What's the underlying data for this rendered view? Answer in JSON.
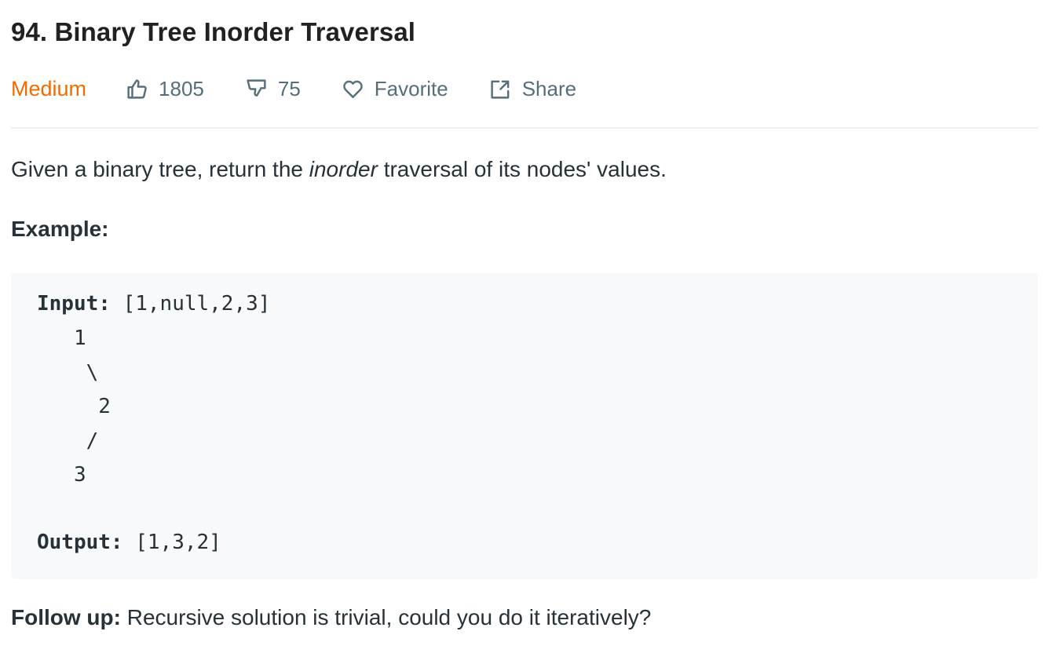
{
  "problem": {
    "title": "94. Binary Tree Inorder Traversal",
    "difficulty": "Medium",
    "likes": "1805",
    "dislikes": "75",
    "favorite_label": "Favorite",
    "share_label": "Share"
  },
  "description": {
    "before_em": "Given a binary tree, return the ",
    "em": "inorder",
    "after_em": " traversal of its nodes' values."
  },
  "example": {
    "heading": "Example:",
    "input_label": "Input:",
    "input_value": " [1,null,2,3]",
    "tree_lines": [
      "   1",
      "    \\",
      "     2",
      "    /",
      "   3"
    ],
    "output_label": "Output:",
    "output_value": " [1,3,2]"
  },
  "followup": {
    "label": "Follow up:",
    "text": " Recursive solution is trivial, could you do it iteratively?"
  },
  "colors": {
    "difficulty_medium": "#ef6c00",
    "meta_text": "#546e7a",
    "code_background": "#f7f9fa"
  },
  "icons": {
    "likes": "thumbs-up-icon",
    "dislikes": "thumbs-down-icon",
    "favorite": "heart-icon",
    "share": "share-icon"
  }
}
